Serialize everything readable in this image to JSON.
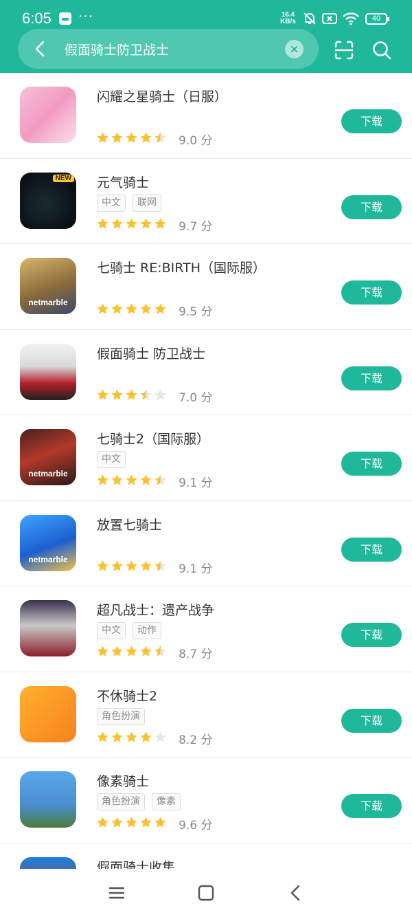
{
  "status_bar": {
    "time": "6:05",
    "speed_value": "16.4",
    "speed_unit": "KB/s",
    "battery": "40"
  },
  "search": {
    "query": "假面骑士防卫战士"
  },
  "colors": {
    "brand": "#1fb89a",
    "star": "#fbc02d",
    "star_empty": "#e6e6e6"
  },
  "apps": [
    {
      "name": "闪耀之星骑士（日服）",
      "tags": [],
      "rating": 4.5,
      "score": "9.0 分",
      "button": "下载",
      "icon_label": "",
      "icon_badge": "",
      "icon_bg": "linear-gradient(135deg,#f6c1d8,#f39ac0 50%,#fbe1ea)"
    },
    {
      "name": "元气骑士",
      "tags": [
        "中文",
        "联网"
      ],
      "rating": 5,
      "score": "9.7 分",
      "button": "下载",
      "icon_label": "",
      "icon_badge": "NEW",
      "icon_bg": "radial-gradient(circle at 45% 55%,#1a2a33,#0c1116 70%), #0c1116"
    },
    {
      "name": "七骑士 RE:BIRTH（国际服）",
      "tags": [],
      "rating": 5,
      "score": "9.5 分",
      "button": "下载",
      "icon_label": "netmarble",
      "icon_badge": "",
      "icon_bg": "linear-gradient(160deg,#d7b56a,#8a6a3a 55%,#3b4a6a)"
    },
    {
      "name": "假面骑士 防卫战士",
      "tags": [],
      "rating": 3.5,
      "score": "7.0 分",
      "button": "下载",
      "icon_label": "",
      "icon_badge": "",
      "icon_bg": "linear-gradient(180deg,#f2f2f2,#d9d9d9 40%,#b3202a 70%,#222)"
    },
    {
      "name": "七骑士2（国际服）",
      "tags": [
        "中文"
      ],
      "rating": 4.5,
      "score": "9.1 分",
      "button": "下载",
      "icon_label": "netmarble",
      "icon_badge": "",
      "icon_bg": "linear-gradient(160deg,#4a1e1e,#b33a2a 45%,#2a1a1a)"
    },
    {
      "name": "放置七骑士",
      "tags": [],
      "rating": 4.5,
      "score": "9.1 分",
      "button": "下载",
      "icon_label": "netmarble",
      "icon_badge": "",
      "icon_bg": "linear-gradient(160deg,#3fa4ff,#1c5fd0 55%,#f3c24a)"
    },
    {
      "name": "超凡战士：遗产战争",
      "tags": [
        "中文",
        "动作"
      ],
      "rating": 4.5,
      "score": "8.7 分",
      "button": "下载",
      "icon_label": "",
      "icon_badge": "",
      "icon_bg": "linear-gradient(180deg,#3a2d4a,#c9c9c9 45%,#8b1e2a)"
    },
    {
      "name": "不休骑士2",
      "tags": [
        "角色扮演"
      ],
      "rating": 4,
      "score": "8.2 分",
      "button": "下载",
      "icon_label": "",
      "icon_badge": "",
      "icon_bg": "linear-gradient(135deg,#ffb02e,#f7821d)"
    },
    {
      "name": "像素骑士",
      "tags": [
        "角色扮演",
        "像素"
      ],
      "rating": 5,
      "score": "9.6 分",
      "button": "下载",
      "icon_label": "",
      "icon_badge": "",
      "icon_bg": "linear-gradient(180deg,#5aa8e8,#4a8ed0 60%,#4c7b3a)"
    },
    {
      "name": "假面骑士收集",
      "tags": [],
      "rating": 0,
      "score": "",
      "button": "",
      "icon_label": "",
      "icon_badge": "",
      "icon_bg": "linear-gradient(180deg,#1d7fd8,#d02a2a)"
    }
  ],
  "nav": {
    "icons": [
      "menu-icon",
      "home-square-icon",
      "back-triangle-icon"
    ]
  }
}
